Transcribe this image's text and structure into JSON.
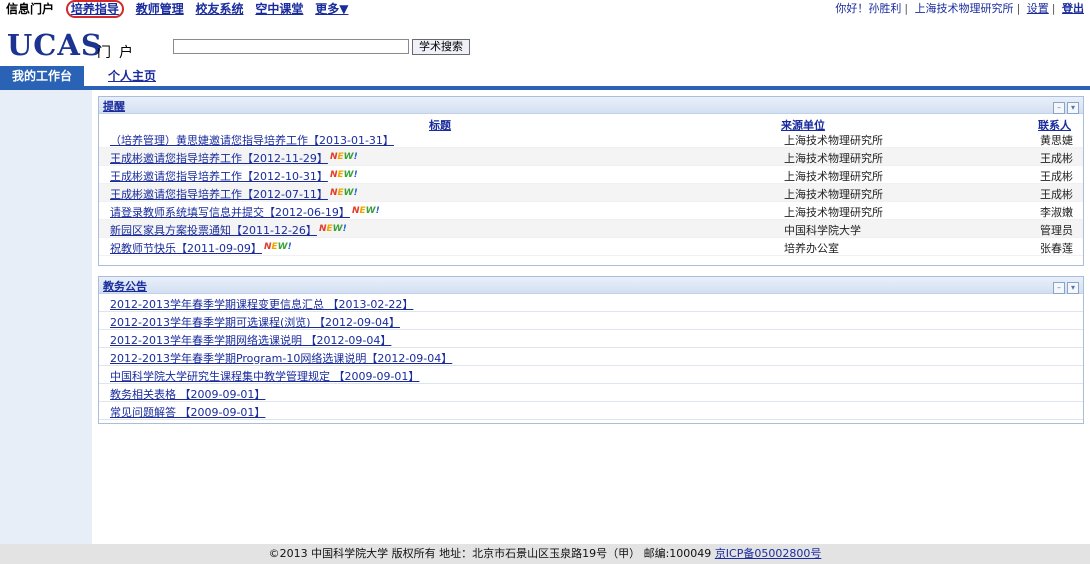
{
  "topnav": {
    "home": "信息门户",
    "items": [
      "培养指导",
      "教师管理",
      "校友系统",
      "空中课堂",
      "更多▼"
    ],
    "greeting": "你好！孙胜利",
    "org": "上海技术物理研究所",
    "settings": "设置",
    "logout": "登出"
  },
  "header": {
    "logo": "UCAS",
    "logo_sub": "门户",
    "search_placeholder": "",
    "search_button": "学术搜索"
  },
  "tabs": {
    "workbench": "我的工作台",
    "profile": "个人主页"
  },
  "reminders": {
    "title": "提醒",
    "columns": {
      "title": "标题",
      "source": "来源单位",
      "contact": "联系人"
    },
    "rows": [
      {
        "title": "（培养管理）黄思婕邀请您指导培养工作【2013-01-31】",
        "new": false,
        "source": "上海技术物理研究所",
        "contact": "黄思婕"
      },
      {
        "title": "王成彬邀请您指导培养工作【2012-11-29】",
        "new": true,
        "source": "上海技术物理研究所",
        "contact": "王成彬"
      },
      {
        "title": "王成彬邀请您指导培养工作【2012-10-31】",
        "new": true,
        "source": "上海技术物理研究所",
        "contact": "王成彬"
      },
      {
        "title": "王成彬邀请您指导培养工作【2012-07-11】",
        "new": true,
        "source": "上海技术物理研究所",
        "contact": "王成彬"
      },
      {
        "title": "请登录教师系统填写信息并提交【2012-06-19】",
        "new": true,
        "source": "上海技术物理研究所",
        "contact": "李淑嫩"
      },
      {
        "title": "新园区家具方案投票通知【2011-12-26】",
        "new": true,
        "source": "中国科学院大学",
        "contact": "管理员"
      },
      {
        "title": "祝教师节快乐【2011-09-09】",
        "new": true,
        "source": "培养办公室",
        "contact": "张春莲"
      }
    ],
    "new_badge": [
      "N",
      "E",
      "W",
      "!"
    ]
  },
  "notices": {
    "title": "教务公告",
    "items": [
      "2012-2013学年春季学期课程变更信息汇总 【2013-02-22】",
      "2012-2013学年春季学期可选课程(浏览) 【2012-09-04】",
      "2012-2013学年春季学期网络选课说明 【2012-09-04】",
      "2012-2013学年春季学期Program-10网络选课说明【2012-09-04】",
      "中国科学院大学研究生课程集中教学管理规定 【2009-09-01】",
      "教务相关表格 【2009-09-01】",
      "常见问题解答 【2009-09-01】"
    ]
  },
  "footer": {
    "text": "©2013 中国科学院大学 版权所有    地址：北京市石景山区玉泉路19号（甲）  邮编:100049",
    "icp": "京ICP备05002800号"
  }
}
